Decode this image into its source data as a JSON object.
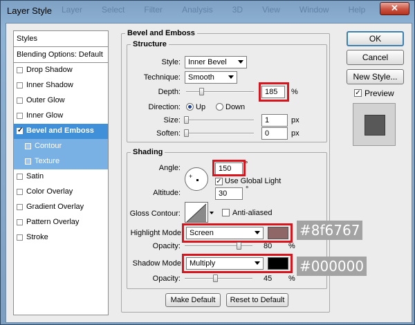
{
  "window": {
    "title": "Layer Style",
    "ghost_menu": [
      "Layer",
      "Select",
      "Filter",
      "Analysis",
      "3D",
      "View",
      "Window",
      "Help"
    ],
    "close_glyph": "✕"
  },
  "styles_panel": {
    "header": "Styles",
    "blending_options": "Blending Options: Default",
    "items": [
      {
        "label": "Drop Shadow",
        "checked": false
      },
      {
        "label": "Inner Shadow",
        "checked": false
      },
      {
        "label": "Outer Glow",
        "checked": false
      },
      {
        "label": "Inner Glow",
        "checked": false
      },
      {
        "label": "Bevel and Emboss",
        "checked": true,
        "active": true
      },
      {
        "label": "Contour",
        "checked": false,
        "sub": true
      },
      {
        "label": "Texture",
        "checked": false,
        "sub": true
      },
      {
        "label": "Satin",
        "checked": false
      },
      {
        "label": "Color Overlay",
        "checked": false
      },
      {
        "label": "Gradient Overlay",
        "checked": false
      },
      {
        "label": "Pattern Overlay",
        "checked": false
      },
      {
        "label": "Stroke",
        "checked": false
      }
    ]
  },
  "bevel": {
    "section_title": "Bevel and Emboss",
    "structure": {
      "title": "Structure",
      "style_label": "Style:",
      "style_value": "Inner Bevel",
      "technique_label": "Technique:",
      "technique_value": "Smooth",
      "depth_label": "Depth:",
      "depth_value": "185",
      "depth_unit": "%",
      "depth_fraction": 0.185,
      "direction_label": "Direction:",
      "direction_up": "Up",
      "direction_down": "Down",
      "direction_selected": "Up",
      "size_label": "Size:",
      "size_value": "1",
      "size_unit": "px",
      "size_fraction": 0.005,
      "soften_label": "Soften:",
      "soften_value": "0",
      "soften_unit": "px",
      "soften_fraction": 0.0
    },
    "shading": {
      "title": "Shading",
      "angle_label": "Angle:",
      "angle_value": "150",
      "angle_unit": "°",
      "use_global_light": "Use Global Light",
      "use_global_light_checked": true,
      "altitude_label": "Altitude:",
      "altitude_value": "30",
      "altitude_unit": "°",
      "gloss_contour_label": "Gloss Contour:",
      "anti_aliased": "Anti-aliased",
      "anti_aliased_checked": false,
      "highlight_mode_label": "Highlight Mode:",
      "highlight_mode_value": "Screen",
      "highlight_color": "#8f6767",
      "highlight_opacity_label": "Opacity:",
      "highlight_opacity_value": "80",
      "highlight_opacity_unit": "%",
      "highlight_opacity_fraction": 0.8,
      "shadow_mode_label": "Shadow Mode:",
      "shadow_mode_value": "Multiply",
      "shadow_color": "#000000",
      "shadow_opacity_label": "Opacity:",
      "shadow_opacity_value": "45",
      "shadow_opacity_unit": "%",
      "shadow_opacity_fraction": 0.45
    },
    "make_default": "Make Default",
    "reset_to_default": "Reset to Default"
  },
  "annotations": {
    "highlight_hex": "#8f6767",
    "shadow_hex": "#000000",
    "box_color": "#d8141c"
  },
  "actions": {
    "ok": "OK",
    "cancel": "Cancel",
    "new_style": "New Style...",
    "preview": "Preview",
    "preview_checked": true
  }
}
